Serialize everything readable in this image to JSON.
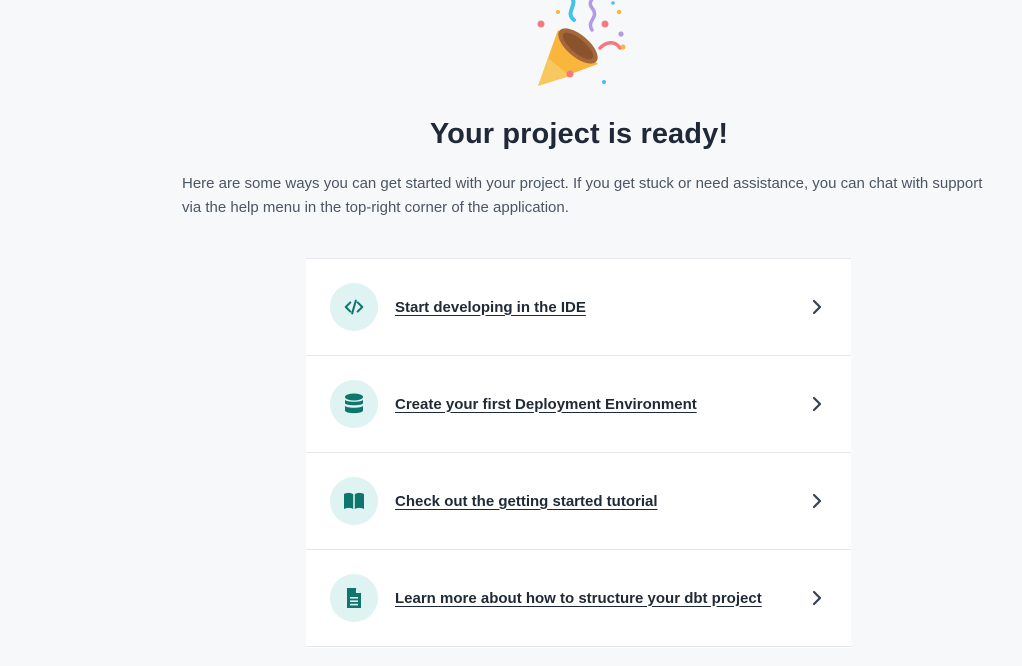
{
  "hero": {
    "title": "Your project is ready!",
    "intro": "Here are some ways you can get started with your project. If you get stuck or need assistance, you can chat with support via the help menu in the top-right corner of the application."
  },
  "actions": [
    {
      "label": "Start developing in the IDE",
      "icon": "code-icon"
    },
    {
      "label": "Create your first Deployment Environment",
      "icon": "database-icon"
    },
    {
      "label": "Check out the getting started tutorial",
      "icon": "book-icon"
    },
    {
      "label": "Learn more about how to structure your dbt project",
      "icon": "document-icon"
    }
  ],
  "colors": {
    "icon_bg": "#dff3f3",
    "icon_fg": "#0f766e",
    "text": "#1f2937",
    "muted": "#4b5563"
  }
}
